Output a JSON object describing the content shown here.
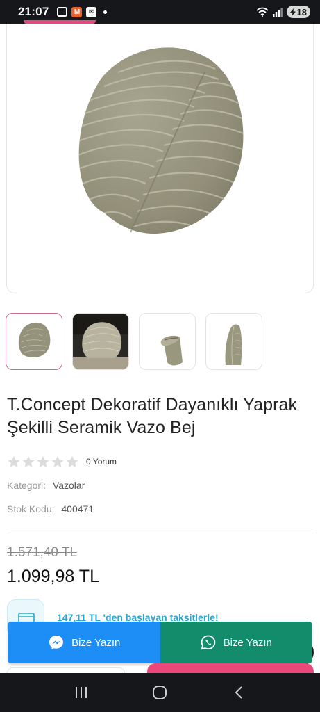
{
  "status_bar": {
    "time": "21:07",
    "notif_m": "M",
    "battery": "18"
  },
  "product": {
    "title": "T.Concept Dekoratif Dayanıklı Yaprak Şekilli Seramik Vazo Bej",
    "rating": 0,
    "review_count": "0 Yorum",
    "category_label": "Kategori",
    "category_value": "Vazolar",
    "sku_label": "Stok Kodu",
    "sku_value": "400471",
    "old_price": "1.571,40 TL",
    "new_price": "1.099,98 TL",
    "installment_text": "147,11 TL 'den başlayan taksitlerle!"
  },
  "thumbnails": [
    {
      "name": "front-view",
      "active": true
    },
    {
      "name": "styled-view",
      "active": false
    },
    {
      "name": "side-view",
      "active": false
    },
    {
      "name": "angle-view",
      "active": false
    }
  ],
  "chat": {
    "messenger_label": "Bize Yazın",
    "whatsapp_label": "Bize Yazın"
  },
  "colors": {
    "accent_pink": "#e8497a",
    "messenger_blue": "#1e8ef7",
    "whatsapp_green": "#128c6a",
    "vase_beige": "#9b9884"
  }
}
